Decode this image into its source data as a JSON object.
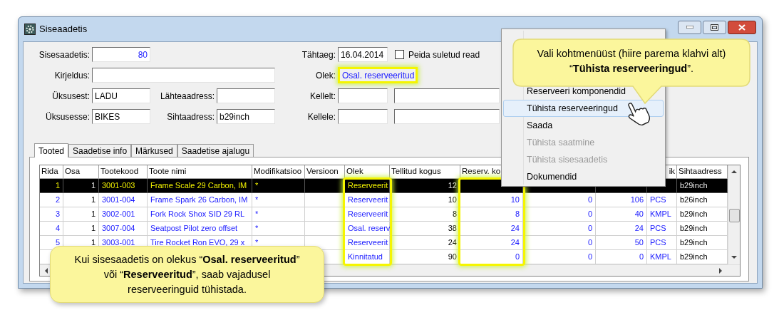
{
  "window": {
    "title": "Siseaadetis"
  },
  "form": {
    "number": {
      "label": "Sisesaadetis:",
      "value": "80"
    },
    "description": {
      "label": "Kirjeldus:"
    },
    "from_unit": {
      "label": "Üksusest:",
      "value": "LADU"
    },
    "to_unit": {
      "label": "Üksusesse:",
      "value": "BIKES"
    },
    "source_address": {
      "label": "Lähteaadress:"
    },
    "target_address": {
      "label": "Sihtaadress:",
      "value": "b29inch"
    },
    "due_date": {
      "label": "Tähtaeg:",
      "value": "16.04.2014"
    },
    "hide_closed": {
      "label": "Peida suletud read",
      "checked": false
    },
    "status": {
      "label": "Olek:",
      "value": "Osal. reserveeritud",
      "highlighted": true
    },
    "from_person": {
      "label": "Kellelt:"
    },
    "to_person": {
      "label": "Kellele:"
    }
  },
  "tabs": [
    {
      "label": "Tooted",
      "selected": true
    },
    {
      "label": "Saadetise info",
      "selected": false
    },
    {
      "label": "Märkused",
      "selected": false
    },
    {
      "label": "Saadetise ajalugu",
      "selected": false
    }
  ],
  "table": {
    "columns": [
      {
        "label": "Rida"
      },
      {
        "label": "Osa"
      },
      {
        "label": "Tootekood"
      },
      {
        "label": "Toote nimi"
      },
      {
        "label": "Modifikatsioo"
      },
      {
        "label": "Versioon"
      },
      {
        "label": "Olek",
        "highlighted": true
      },
      {
        "label": "Tellitud kogus"
      },
      {
        "label": "Reserv. ko",
        "highlighted": true
      },
      {},
      {},
      {
        "label": "ik"
      },
      {
        "label": "Sihtaadress"
      }
    ],
    "rows": [
      {
        "selected": true,
        "cells": [
          "1",
          "1",
          "3001-003",
          "Frame Scale 29 Carbon, IM",
          "*",
          null,
          "Reserveerit",
          "12",
          null,
          null,
          null,
          null,
          "b29inch"
        ]
      },
      {
        "selected": false,
        "cells": [
          "2",
          "1",
          "3001-004",
          "Frame Spark 26 Carbon, IM",
          "*",
          null,
          "Reserveerit",
          "10",
          "10",
          "0",
          "106",
          "PCS",
          "b26inch"
        ]
      },
      {
        "selected": false,
        "cells": [
          "3",
          "1",
          "3002-001",
          "Fork Rock Shox SID 29 RL",
          "*",
          null,
          "Reserveerit",
          "8",
          "8",
          "0",
          "40",
          "KMPL",
          "b29inch"
        ]
      },
      {
        "selected": false,
        "cells": [
          "4",
          "1",
          "3007-004",
          "Seatpost Pilot zero offset",
          "*",
          null,
          "Osal. reserv",
          "38",
          "24",
          "0",
          "24",
          "PCS",
          "b29inch"
        ]
      },
      {
        "selected": false,
        "cells": [
          "5",
          "1",
          "3003-001",
          "Tire Rocket Ron EVO, 29 x",
          "*",
          null,
          "Reserveerit",
          "24",
          "24",
          "0",
          "50",
          "PCS",
          "b29inch"
        ]
      },
      {
        "selected": false,
        "cells": [
          null,
          null,
          null,
          null,
          null,
          null,
          "Kinnitatud",
          "90",
          "0",
          "0",
          "0",
          "KMPL",
          "b29inch"
        ]
      }
    ]
  },
  "context_menu": {
    "items": [
      {
        "label": "Reserveeri komponendid",
        "selected": false,
        "disabled": false
      },
      {
        "label": "Tühista reserveeringud",
        "selected": true,
        "disabled": false
      },
      {
        "label": "Saada",
        "selected": false,
        "disabled": false
      },
      {
        "label": "Tühista saatmine",
        "selected": false,
        "disabled": true
      },
      {
        "label": "Tühista sisesaadetis",
        "selected": false,
        "disabled": true
      },
      {
        "label": "Dokumendid",
        "selected": false,
        "disabled": false
      }
    ]
  },
  "callouts": [
    {
      "text": "Vali kohtmenüüst (hiire parema klahvi alt)\n“**Tühista reserveeringud**”."
    },
    {
      "text": "Kui sisesaadetis on olekus “**Osal. reserveeritud**”\nvõi “**Reserveeritud**”, saab vajadusel\nreserveeringuid tühistada."
    }
  ]
}
